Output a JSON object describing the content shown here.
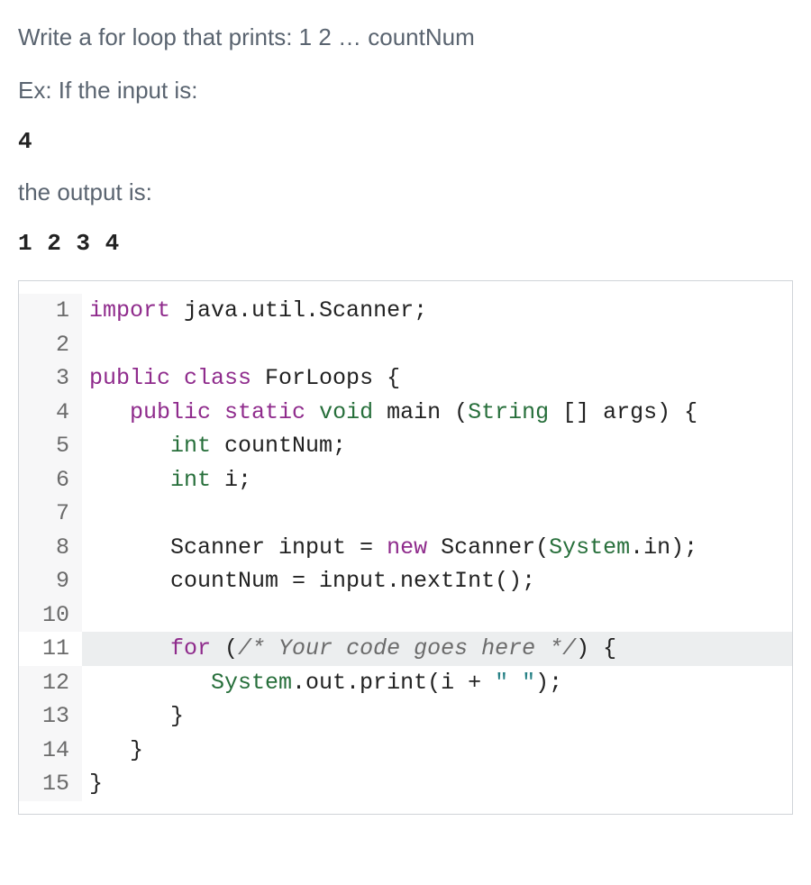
{
  "prompt": {
    "question": "Write a for loop that prints: 1 2 … countNum",
    "example_label": "Ex: If the input is:",
    "example_input": "4",
    "output_label": "the output is:",
    "example_output": "1 2 3 4"
  },
  "code": {
    "lines": [
      {
        "n": "1",
        "tokens": [
          [
            "import ",
            "keyword"
          ],
          [
            "java.util.Scanner;",
            "plain"
          ]
        ]
      },
      {
        "n": "2",
        "tokens": []
      },
      {
        "n": "3",
        "tokens": [
          [
            "public class ",
            "keyword"
          ],
          [
            "ForLoops {",
            "plain"
          ]
        ]
      },
      {
        "n": "4",
        "tokens": [
          [
            "   ",
            "plain"
          ],
          [
            "public static ",
            "keyword"
          ],
          [
            "void ",
            "type"
          ],
          [
            "main (",
            "plain"
          ],
          [
            "String",
            "type"
          ],
          [
            " [] args) {",
            "plain"
          ]
        ]
      },
      {
        "n": "5",
        "tokens": [
          [
            "      ",
            "plain"
          ],
          [
            "int ",
            "type"
          ],
          [
            "countNum;",
            "plain"
          ]
        ]
      },
      {
        "n": "6",
        "tokens": [
          [
            "      ",
            "plain"
          ],
          [
            "int ",
            "type"
          ],
          [
            "i;",
            "plain"
          ]
        ]
      },
      {
        "n": "7",
        "tokens": []
      },
      {
        "n": "8",
        "tokens": [
          [
            "      Scanner input = ",
            "plain"
          ],
          [
            "new ",
            "keyword"
          ],
          [
            "Scanner(",
            "plain"
          ],
          [
            "System",
            "type"
          ],
          [
            ".in);",
            "plain"
          ]
        ]
      },
      {
        "n": "9",
        "tokens": [
          [
            "      countNum = input.nextInt();",
            "plain"
          ]
        ]
      },
      {
        "n": "10",
        "tokens": []
      },
      {
        "n": "11",
        "highlight": true,
        "tokens": [
          [
            "      ",
            "plain"
          ],
          [
            "for ",
            "keyword"
          ],
          [
            "(",
            "plain"
          ],
          [
            "/* Your code goes here */",
            "comment"
          ],
          [
            ") {",
            "plain"
          ]
        ]
      },
      {
        "n": "12",
        "tokens": [
          [
            "         ",
            "plain"
          ],
          [
            "System",
            "type"
          ],
          [
            ".out.print(i + ",
            "plain"
          ],
          [
            "\" \"",
            "string"
          ],
          [
            ");",
            "plain"
          ]
        ]
      },
      {
        "n": "13",
        "tokens": [
          [
            "      }",
            "plain"
          ]
        ]
      },
      {
        "n": "14",
        "tokens": [
          [
            "   }",
            "plain"
          ]
        ]
      },
      {
        "n": "15",
        "tokens": [
          [
            "}",
            "plain"
          ]
        ]
      }
    ]
  }
}
